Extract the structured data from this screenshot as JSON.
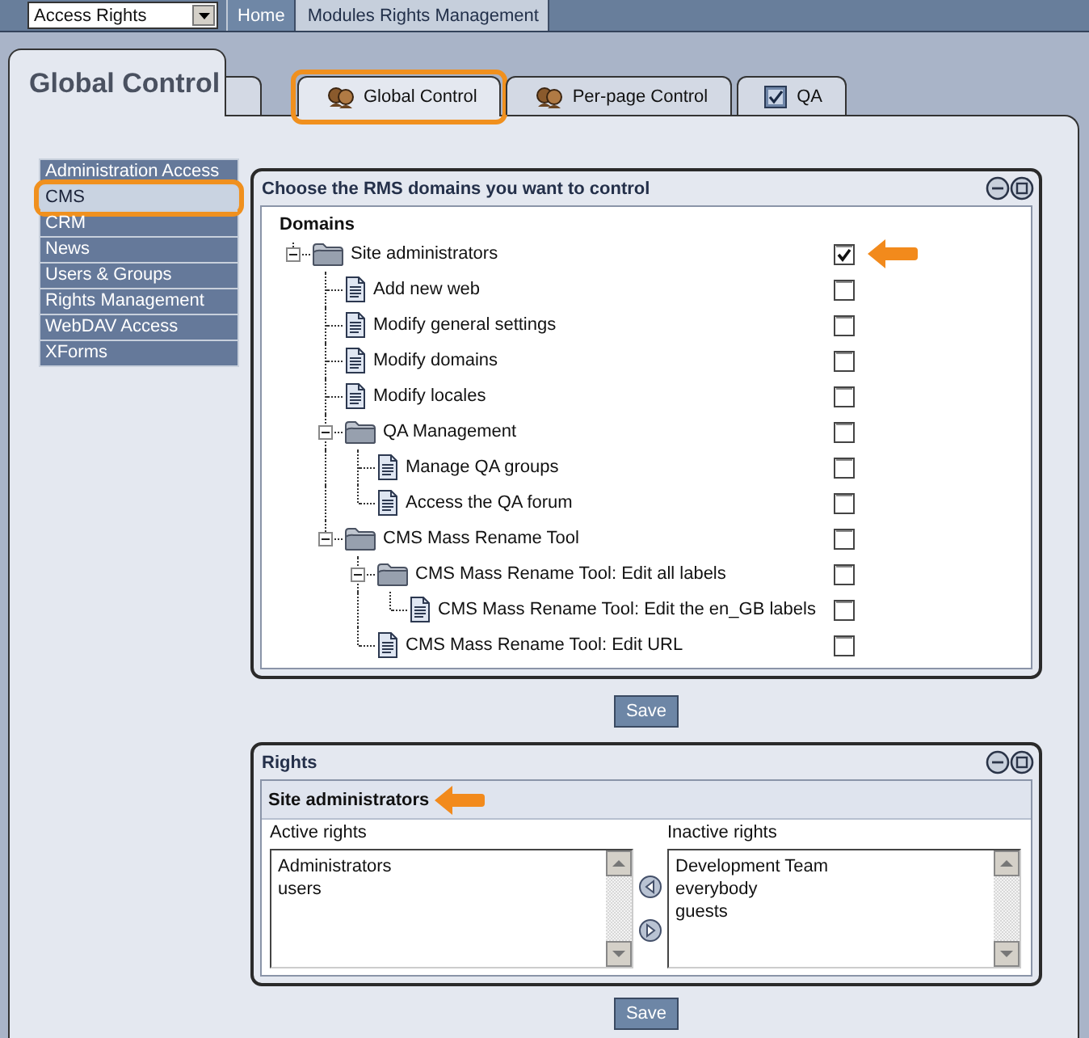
{
  "top_bar": {
    "module_select": {
      "value": "Access Rights"
    },
    "breadcrumbs": [
      {
        "label": "Home",
        "current": false
      },
      {
        "label": "Modules Rights Management",
        "current": true
      }
    ]
  },
  "page_title": "Global Control",
  "tabs": [
    {
      "label": "Global Control",
      "kind": "people",
      "selected": true,
      "highlighted": true
    },
    {
      "label": "Per-page Control",
      "kind": "people",
      "selected": false,
      "highlighted": false
    },
    {
      "label": "QA",
      "kind": "checkbox",
      "selected": false,
      "highlighted": false
    }
  ],
  "sidebar": {
    "items": [
      {
        "label": "Administration Access",
        "selected": false,
        "highlighted": false
      },
      {
        "label": "CMS",
        "selected": true,
        "highlighted": true
      },
      {
        "label": "CRM",
        "selected": false,
        "highlighted": false
      },
      {
        "label": "News",
        "selected": false,
        "highlighted": false
      },
      {
        "label": "Users & Groups",
        "selected": false,
        "highlighted": false
      },
      {
        "label": "Rights Management",
        "selected": false,
        "highlighted": false
      },
      {
        "label": "WebDAV Access",
        "selected": false,
        "highlighted": false
      },
      {
        "label": "XForms",
        "selected": false,
        "highlighted": false
      }
    ]
  },
  "domains_panel": {
    "title": "Choose the RMS domains you want to control",
    "heading": "Domains",
    "tree": [
      {
        "label": "Site administrators",
        "kind": "folder",
        "expanded": true,
        "checked": true,
        "pointer": true,
        "children": [
          {
            "label": "Add new web",
            "kind": "page",
            "checked": false,
            "pointer": false
          },
          {
            "label": "Modify general settings",
            "kind": "page",
            "checked": false,
            "pointer": false
          },
          {
            "label": "Modify domains",
            "kind": "page",
            "checked": false,
            "pointer": false
          },
          {
            "label": "Modify locales",
            "kind": "page",
            "checked": false,
            "pointer": false
          },
          {
            "label": "QA Management",
            "kind": "folder",
            "expanded": true,
            "checked": false,
            "pointer": false,
            "children": [
              {
                "label": "Manage QA groups",
                "kind": "page",
                "checked": false,
                "pointer": false
              },
              {
                "label": "Access the QA forum",
                "kind": "page",
                "checked": false,
                "pointer": false
              }
            ]
          },
          {
            "label": "CMS Mass Rename Tool",
            "kind": "folder",
            "expanded": true,
            "checked": false,
            "pointer": false,
            "children": [
              {
                "label": "CMS Mass Rename Tool: Edit all labels",
                "kind": "folder",
                "expanded": true,
                "checked": false,
                "pointer": false,
                "children": [
                  {
                    "label": "CMS Mass Rename Tool: Edit the en_GB labels",
                    "kind": "page",
                    "checked": false,
                    "pointer": false
                  }
                ]
              },
              {
                "label": "CMS Mass Rename Tool: Edit URL",
                "kind": "page",
                "checked": false,
                "pointer": false
              }
            ]
          }
        ]
      }
    ],
    "save_button": "Save"
  },
  "rights_panel": {
    "title": "Rights",
    "subject": "Site administrators",
    "subject_pointer": true,
    "active": {
      "label": "Active rights",
      "items": [
        "Administrators",
        "users"
      ]
    },
    "inactive": {
      "label": "Inactive rights",
      "items": [
        "Development Team",
        "everybody",
        "guests"
      ]
    },
    "save_button": "Save"
  }
}
